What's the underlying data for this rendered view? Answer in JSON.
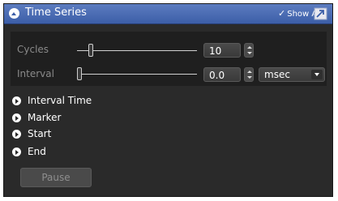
{
  "header": {
    "title": "Time Series",
    "show_all_label": "Show All"
  },
  "controls": {
    "cycles": {
      "label": "Cycles",
      "value": "10"
    },
    "interval": {
      "label": "Interval",
      "value": "0.0",
      "unit": "msec"
    }
  },
  "sections": [
    {
      "label": "Interval Time"
    },
    {
      "label": "Marker"
    },
    {
      "label": "Start"
    },
    {
      "label": "End"
    }
  ],
  "pause_label": "Pause"
}
